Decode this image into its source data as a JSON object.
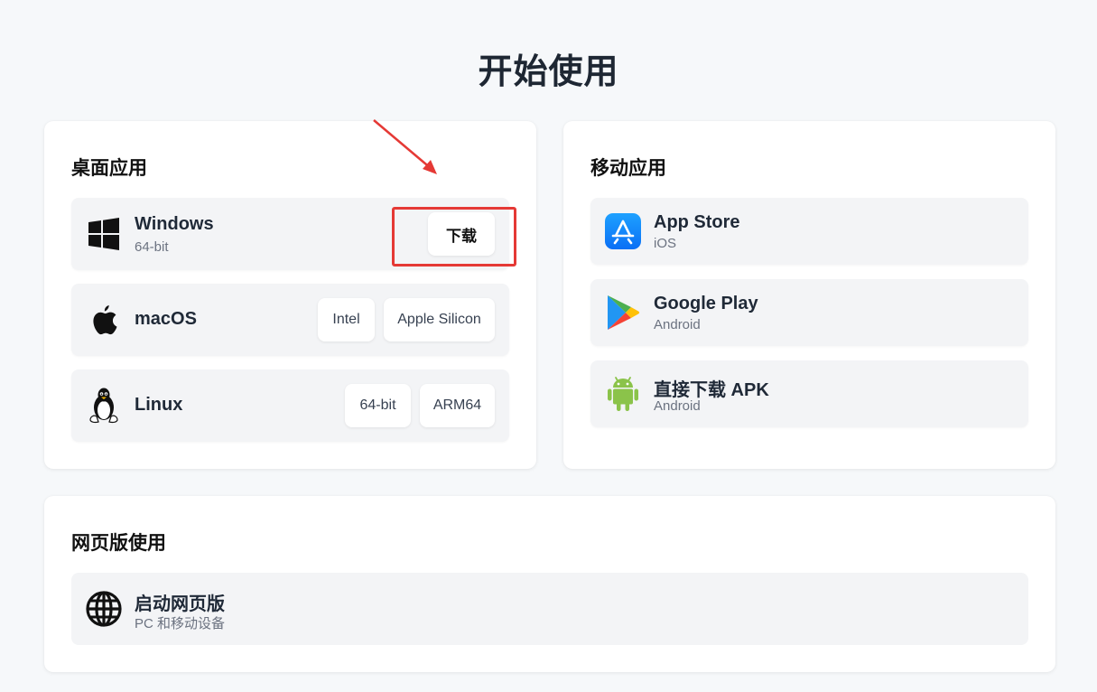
{
  "page": {
    "title": "开始使用"
  },
  "desktop": {
    "title": "桌面应用",
    "windows": {
      "name": "Windows",
      "sub": "64-bit",
      "download": "下载"
    },
    "macos": {
      "name": "macOS",
      "btn1": "Intel",
      "btn2": "Apple Silicon"
    },
    "linux": {
      "name": "Linux",
      "btn1": "64-bit",
      "btn2": "ARM64"
    }
  },
  "mobile": {
    "title": "移动应用",
    "appstore": {
      "name": "App Store",
      "sub": "iOS"
    },
    "googleplay": {
      "name": "Google Play",
      "sub": "Android"
    },
    "apk": {
      "name": "直接下载 APK",
      "sub": "Android"
    }
  },
  "web": {
    "title": "网页版使用",
    "launch": {
      "name": "启动网页版",
      "sub": "PC 和移动设备"
    }
  },
  "colors": {
    "highlight": "#e53935",
    "appstore": "#1a8cff",
    "android": "#8bc34a"
  },
  "icons": [
    "windows-icon",
    "apple-icon",
    "linux-icon",
    "app-store-icon",
    "google-play-icon",
    "android-icon",
    "globe-icon"
  ]
}
